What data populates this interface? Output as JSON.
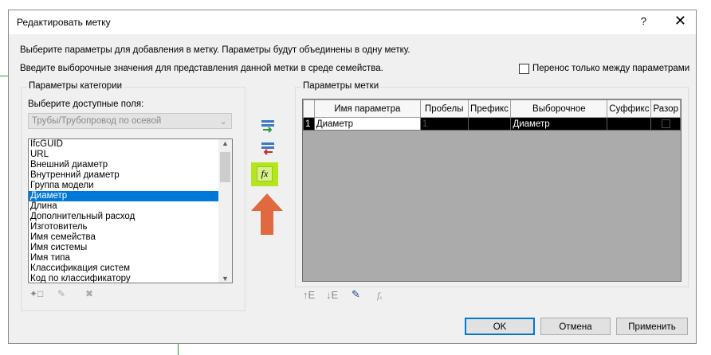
{
  "dialog": {
    "title": "Редактировать метку",
    "help_glyph": "?",
    "close_glyph": "✕",
    "instruction1": "Выберите параметры для добавления в метку.  Параметры будут объединены в одну метку.",
    "instruction2": "Введите выборочные значения для представления данной метки в среде семейства.",
    "checkbox_label": "Перенос только между параметрами",
    "checkbox_checked": false
  },
  "left_group": {
    "title": "Параметры категории",
    "fields_label": "Выберите доступные поля:",
    "category_value": "Трубы/Трубопровод по осевой",
    "items": [
      "IfcGUID",
      "URL",
      "Внешний диаметр",
      "Внутренний диаметр",
      "Группа модели",
      "Диаметр",
      "Длина",
      "Дополнительный расход",
      "Изготовитель",
      "Имя семейства",
      "Имя системы",
      "Имя типа",
      "Классификация систем",
      "Код по классификатору"
    ],
    "selected_index": 5
  },
  "middle": {
    "add_icon": "add-parameter-icon",
    "remove_icon": "remove-parameter-icon",
    "fx_label": "fx",
    "arrow_color": "#e0693f",
    "fx_highlight": "#b5e61d"
  },
  "right_group": {
    "title": "Параметры метки",
    "columns": [
      "Имя параметра",
      "Пробелы",
      "Префикс",
      "Выборочное",
      "Суффикс",
      "Разор"
    ],
    "rows": [
      {
        "num": "1",
        "name": "Диаметр",
        "spaces": "1",
        "prefix": "",
        "sample": "Диаметр",
        "suffix": "",
        "break": false
      }
    ],
    "toolbar_icons": [
      "move-up-icon",
      "move-down-icon",
      "edit-format-icon",
      "formula-icon"
    ]
  },
  "buttons": {
    "ok": "OK",
    "cancel": "Отмена",
    "apply": "Применить"
  }
}
